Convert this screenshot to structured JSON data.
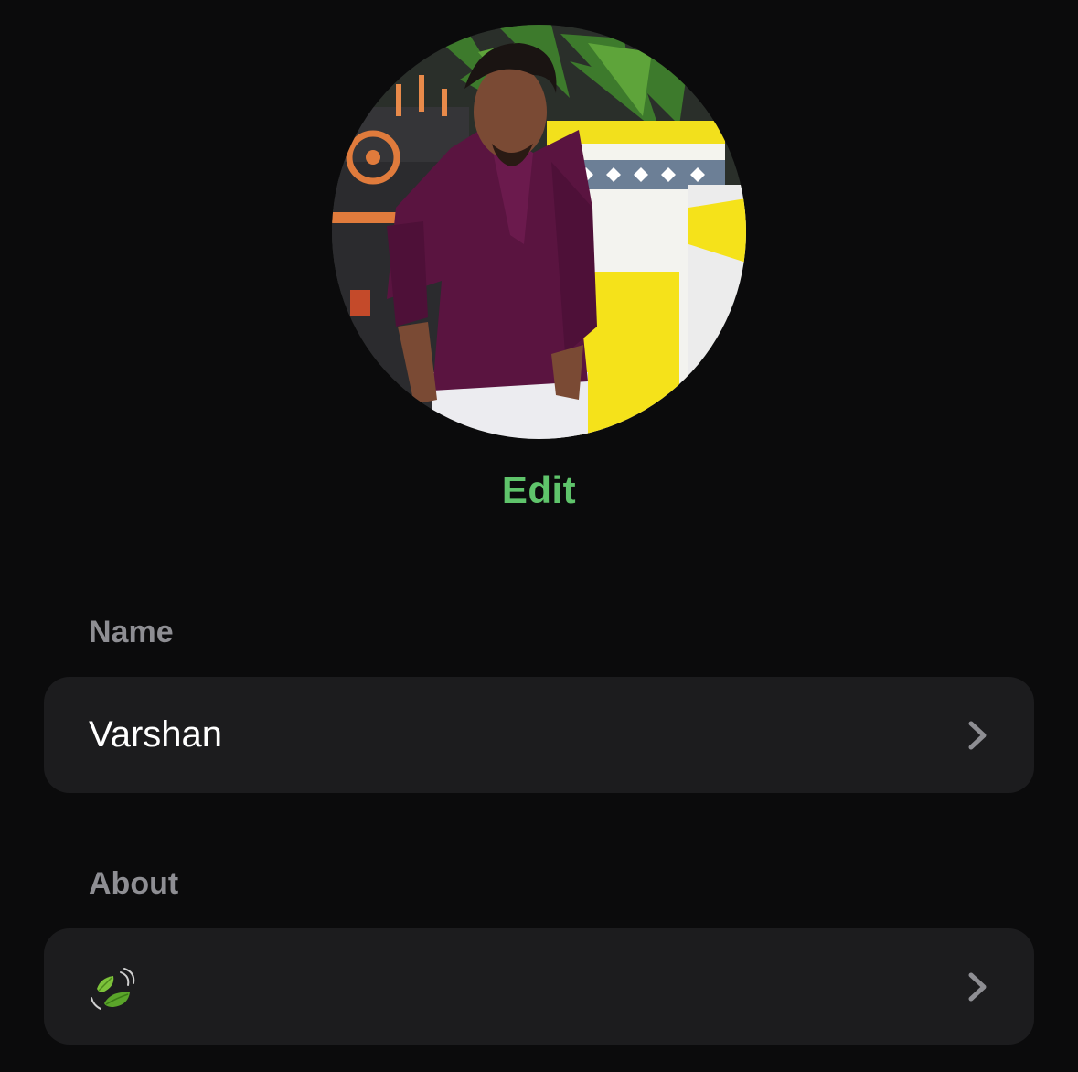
{
  "profile": {
    "photo_icon": "profile-photo",
    "edit_label": "Edit"
  },
  "name_section": {
    "label": "Name",
    "value": "Varshan",
    "chevron_icon": "chevron-right-icon"
  },
  "about_section": {
    "label": "About",
    "value_icon": "leaf-fluttering-in-wind-icon",
    "chevron_icon": "chevron-right-icon"
  },
  "colors": {
    "background": "#0b0b0c",
    "row_background": "#1c1c1e",
    "accent_green": "#5fc46b",
    "label_gray": "#8e8e93"
  }
}
